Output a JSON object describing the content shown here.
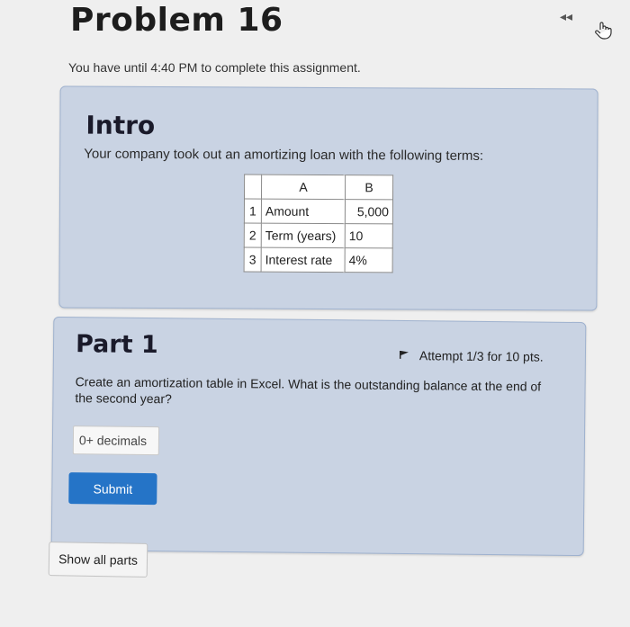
{
  "header": {
    "title": "Problem 16",
    "nav_back": "◂◂",
    "hand_icon": "pointer-hand-icon"
  },
  "deadline": "You have until 4:40 PM to complete this assignment.",
  "intro": {
    "heading": "Intro",
    "text": "Your company took out an amortizing loan with the following terms:",
    "table": {
      "col_headers": [
        "A",
        "B"
      ],
      "rows": [
        {
          "n": "1",
          "label": "Amount",
          "value": "5,000"
        },
        {
          "n": "2",
          "label": "Term (years)",
          "value": "10"
        },
        {
          "n": "3",
          "label": "Interest rate",
          "value": "4%"
        }
      ]
    }
  },
  "part1": {
    "heading": "Part 1",
    "attempt": "Attempt 1/3 for 10 pts.",
    "flag_icon": "flag-icon",
    "question": "Create an amortization table in Excel. What is the outstanding balance at the end of the second year?",
    "input_placeholder": "0+ decimals",
    "submit_label": "Submit"
  },
  "show_all_label": "Show all parts",
  "colors": {
    "card_bg": "#c9d3e3",
    "submit_bg": "#2574c7"
  }
}
